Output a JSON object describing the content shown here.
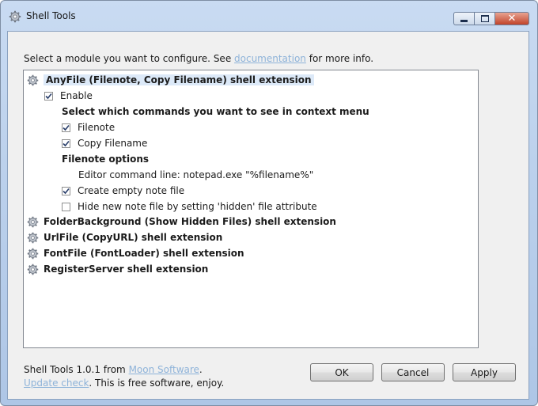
{
  "window": {
    "title": "Shell Tools"
  },
  "prompt": {
    "before": "Select a module you want to configure. See ",
    "link": "documentation",
    "after": " for more info."
  },
  "modules": [
    {
      "label": "AnyFile (Filenote, Copy Filename) shell extension",
      "selected": true
    },
    {
      "label": "FolderBackground (Show Hidden Files) shell extension"
    },
    {
      "label": "UrlFile (CopyURL) shell extension"
    },
    {
      "label": "FontFile (FontLoader) shell extension"
    },
    {
      "label": "RegisterServer shell extension"
    }
  ],
  "anyfile": {
    "enable": {
      "label": "Enable",
      "checked": true
    },
    "commands_heading": "Select which commands you want to see in context menu",
    "filenote": {
      "label": "Filenote",
      "checked": true
    },
    "copy_filename": {
      "label": "Copy Filename",
      "checked": true
    },
    "options_heading": "Filenote options",
    "editor_line": "Editor command line: notepad.exe \"%filename%\"",
    "create_empty": {
      "label": "Create empty note file",
      "checked": true
    },
    "hide_new": {
      "label": "Hide new note file by setting 'hidden' file attribute",
      "checked": false
    }
  },
  "footer": {
    "version_text": "Shell Tools 1.0.1 from ",
    "vendor_link": "Moon Software",
    "version_end": ".",
    "update_link": "Update check",
    "update_text": ". This is free software, enjoy."
  },
  "buttons": {
    "ok": "OK",
    "cancel": "Cancel",
    "apply": "Apply"
  },
  "icons": {
    "title": "gear-icon",
    "module": "gear-icon"
  },
  "colors": {
    "link": "#8eb3d9",
    "selection": "#dce9f8",
    "titlebar": "#bcd1ec",
    "close": "#c1432a"
  }
}
